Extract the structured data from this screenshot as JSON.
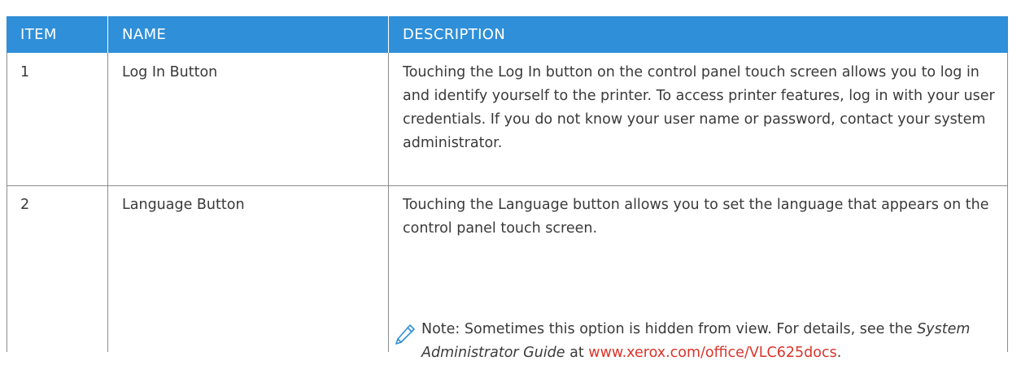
{
  "table": {
    "headers": {
      "item": "ITEM",
      "name": "NAME",
      "description": "DESCRIPTION"
    },
    "rows": [
      {
        "item": "1",
        "name": "Log In Button",
        "description": "Touching the Log In button on the control panel touch screen allows you to log in and identify yourself to the printer. To access printer features, log in with your user credentials. If you do not know your user name or password, contact your system administrator."
      },
      {
        "item": "2",
        "name": "Language Button",
        "description": "Touching the Language button allows you to set the language that appears on the control panel touch screen.",
        "note": {
          "icon": "pencil-icon",
          "prefix": "Note: Sometimes this option is hidden from view. For details, see the ",
          "guide_title": "System Administrator Guide",
          "middle": " at ",
          "link_text": "www.xerox.com/office/VLC625docs",
          "suffix": "."
        }
      }
    ]
  },
  "colors": {
    "header_bg": "#2f8fd8",
    "header_text": "#ffffff",
    "body_text": "#3a3a3a",
    "link": "#d9342b",
    "grid": "#8c8c8c"
  }
}
